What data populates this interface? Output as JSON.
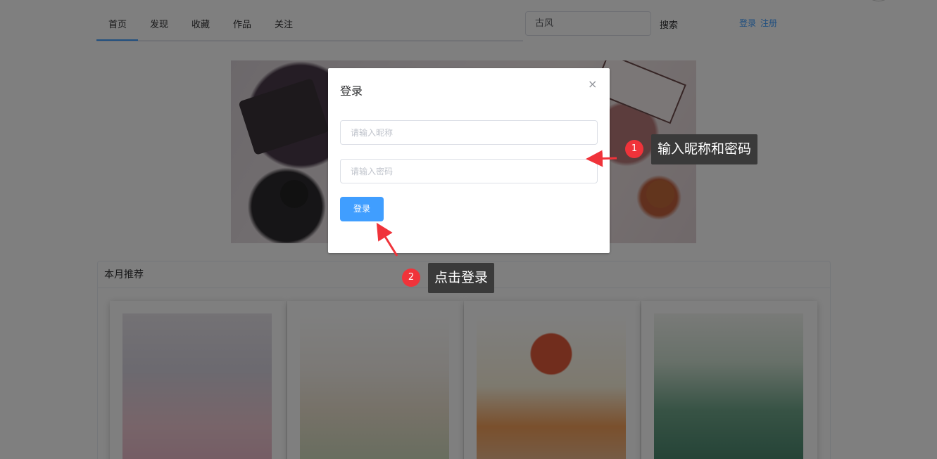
{
  "nav": {
    "tabs": [
      {
        "label": "首页",
        "active": true
      },
      {
        "label": "发现",
        "active": false
      },
      {
        "label": "收藏",
        "active": false
      },
      {
        "label": "作品",
        "active": false
      },
      {
        "label": "关注",
        "active": false
      }
    ]
  },
  "search": {
    "value": "古风",
    "button_label": "搜索"
  },
  "auth": {
    "login_label": "登录",
    "register_label": "注册"
  },
  "recommend": {
    "title": "本月推荐"
  },
  "dialog": {
    "title": "登录",
    "close_icon": "×",
    "nickname_placeholder": "请输入昵称",
    "password_placeholder": "请输入密码",
    "submit_label": "登录"
  },
  "annotations": [
    {
      "number": "1",
      "text": "输入昵称和密码"
    },
    {
      "number": "2",
      "text": "点击登录"
    }
  ],
  "colors": {
    "accent": "#409eff",
    "annotation_badge": "#f0333a",
    "annotation_bg": "#3a3a3a"
  }
}
